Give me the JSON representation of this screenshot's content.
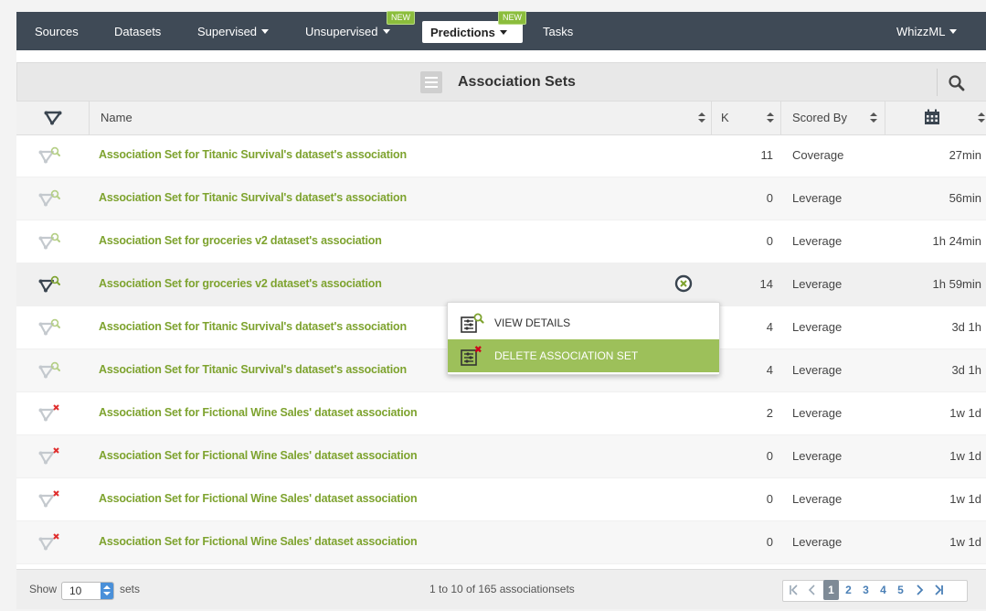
{
  "nav": {
    "items": [
      {
        "label": "Sources"
      },
      {
        "label": "Datasets"
      },
      {
        "label": "Supervised"
      },
      {
        "label": "Unsupervised",
        "badge": "NEW"
      },
      {
        "label": "Predictions",
        "badge": "NEW"
      },
      {
        "label": "Tasks"
      }
    ],
    "user_menu": "WhizzML"
  },
  "panel": {
    "title": "Association Sets"
  },
  "columns": {
    "name": "Name",
    "k": "K",
    "scored_by": "Scored By"
  },
  "rows": [
    {
      "name": "Association Set for Titanic Survival's dataset's association",
      "k": "11",
      "scored_by": "Coverage",
      "age": "27min",
      "status": "ok"
    },
    {
      "name": "Association Set for Titanic Survival's dataset's association",
      "k": "0",
      "scored_by": "Leverage",
      "age": "56min",
      "status": "ok"
    },
    {
      "name": "Association Set for groceries v2 dataset's association",
      "k": "0",
      "scored_by": "Leverage",
      "age": "1h 24min",
      "status": "ok"
    },
    {
      "name": "Association Set for groceries v2 dataset's association",
      "k": "14",
      "scored_by": "Leverage",
      "age": "1h 59min",
      "status": "ok"
    },
    {
      "name": "Association Set for Titanic Survival's dataset's association",
      "k": "4",
      "scored_by": "Leverage",
      "age": "3d 1h",
      "status": "ok"
    },
    {
      "name": "Association Set for Titanic Survival's dataset's association",
      "k": "4",
      "scored_by": "Leverage",
      "age": "3d 1h",
      "status": "ok"
    },
    {
      "name": "Association Set for Fictional Wine Sales' dataset association",
      "k": "2",
      "scored_by": "Leverage",
      "age": "1w 1d",
      "status": "error"
    },
    {
      "name": "Association Set for Fictional Wine Sales' dataset association",
      "k": "0",
      "scored_by": "Leverage",
      "age": "1w 1d",
      "status": "error"
    },
    {
      "name": "Association Set for Fictional Wine Sales' dataset association",
      "k": "0",
      "scored_by": "Leverage",
      "age": "1w 1d",
      "status": "error"
    },
    {
      "name": "Association Set for Fictional Wine Sales' dataset association",
      "k": "0",
      "scored_by": "Leverage",
      "age": "1w 1d",
      "status": "error"
    }
  ],
  "context_menu": {
    "view_details": "VIEW DETAILS",
    "delete": "DELETE ASSOCIATION SET"
  },
  "footer": {
    "show_label": "Show",
    "page_size": "10",
    "sets_label": "sets",
    "range_text": "1 to 10 of 165 associationsets",
    "pages": [
      "1",
      "2",
      "3",
      "4",
      "5"
    ],
    "current_page": "1"
  },
  "colors": {
    "nav_bg": "#3f4a56",
    "accent_green": "#8bbd3c",
    "link_green": "#7ea32f",
    "menu_highlight": "#9dc05a"
  }
}
